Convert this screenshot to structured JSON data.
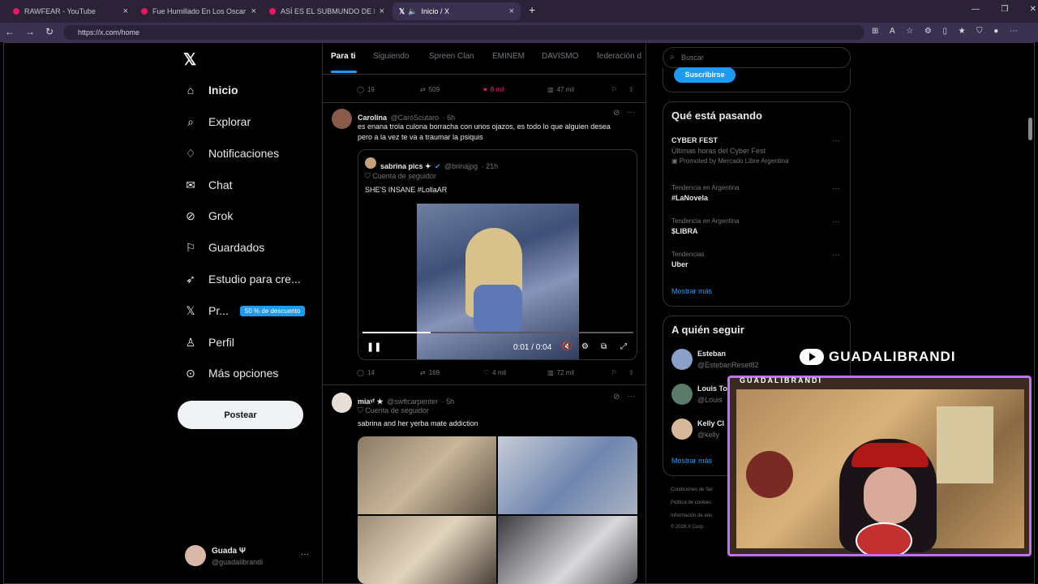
{
  "browser": {
    "tabs": [
      {
        "title": "RAWFEAR - YouTube",
        "active": false
      },
      {
        "title": "Fue Humillado En Los Oscar - You",
        "active": false
      },
      {
        "title": "ASÍ ES EL SUBMUNDO DE RIO DE",
        "active": false
      },
      {
        "title": "Inicio / X",
        "active": true
      }
    ],
    "new_tab": "+",
    "url": "https://x.com/home"
  },
  "sidebar": {
    "logo": "X",
    "items": [
      {
        "label": "Inicio",
        "icon": "home-icon"
      },
      {
        "label": "Explorar",
        "icon": "search-icon"
      },
      {
        "label": "Notificaciones",
        "icon": "bell-icon"
      },
      {
        "label": "Chat",
        "icon": "mail-icon"
      },
      {
        "label": "Grok",
        "icon": "grok-icon"
      },
      {
        "label": "Guardados",
        "icon": "bookmark-icon"
      },
      {
        "label": "Estudio para cre...",
        "icon": "rocket-icon"
      },
      {
        "label": "Pr...",
        "icon": "x-premium-icon",
        "badge": "50 % de descuento"
      },
      {
        "label": "Perfil",
        "icon": "person-icon"
      },
      {
        "label": "Más opciones",
        "icon": "more-circle-icon"
      }
    ],
    "post_button": "Postear",
    "account": {
      "name": "Guada Ψ",
      "handle": "@guadalibrandi",
      "more": "···"
    }
  },
  "timeline": {
    "tabs": [
      "Para ti",
      "Siguiendo",
      "Spreen Clan",
      "EMINEM",
      "DAVISMO",
      "federación d"
    ],
    "prev_actions": {
      "replies": "19",
      "reposts": "509",
      "likes": "6 mil",
      "views": "47 mil"
    },
    "post1": {
      "name": "Carolina",
      "handle": "@CaroScutaro",
      "time": "· 6h",
      "text": "es enana trola culona borracha con unos ojazos, es todo lo que alguien desea pero a la vez te va a traumar la psiquis",
      "quote": {
        "name": "sabrina pics ✦",
        "handle": "@brinajpg",
        "time": "· 21h",
        "label": "Cuenta de seguidor",
        "text": "SHE'S INSANE #LollaAR",
        "video_time": "0:01 / 0:04",
        "progress": 0.25
      },
      "actions": {
        "replies": "14",
        "reposts": "169",
        "likes": "4 mil",
        "views": "72 mil"
      }
    },
    "post2": {
      "name": "miaᵞᶠ ★",
      "handle": "@swftcarpenter",
      "time": "· 5h",
      "label": "Cuenta de seguidor",
      "text": "sabrina and her yerba mate addiction"
    }
  },
  "right": {
    "search_placeholder": "Buscar",
    "subscribe": "Suscribirse",
    "trends_title": "Qué está pasando",
    "trends": [
      {
        "top": "",
        "title": "CYBER FEST",
        "sub": "Últimas horas del Cyber Fest",
        "promo": "Promoted by Mercado Libre Argentina"
      },
      {
        "top": "Tendencia en Argentina",
        "title": "#LaNovela"
      },
      {
        "top": "Tendencia en Argentina",
        "title": "$LIBRA"
      },
      {
        "top": "Tendencias",
        "title": "Uber"
      }
    ],
    "show_more": "Mostrar más",
    "follow_title": "A quién seguir",
    "follow": [
      {
        "name": "Esteban",
        "handle": "@EstebanReset82"
      },
      {
        "name": "Louis To",
        "handle": "@Louis"
      },
      {
        "name": "Kelly Cl",
        "handle": "@kelly"
      }
    ],
    "follow_more": "Mostrar más",
    "footer": [
      "Condiciones de Ser",
      "Política de cookies",
      "Información de anu",
      "© 2026 X Corp."
    ]
  },
  "overlay": {
    "brand": "GUADALIBRANDI",
    "cam_label": "GUADALIBRANDI"
  }
}
